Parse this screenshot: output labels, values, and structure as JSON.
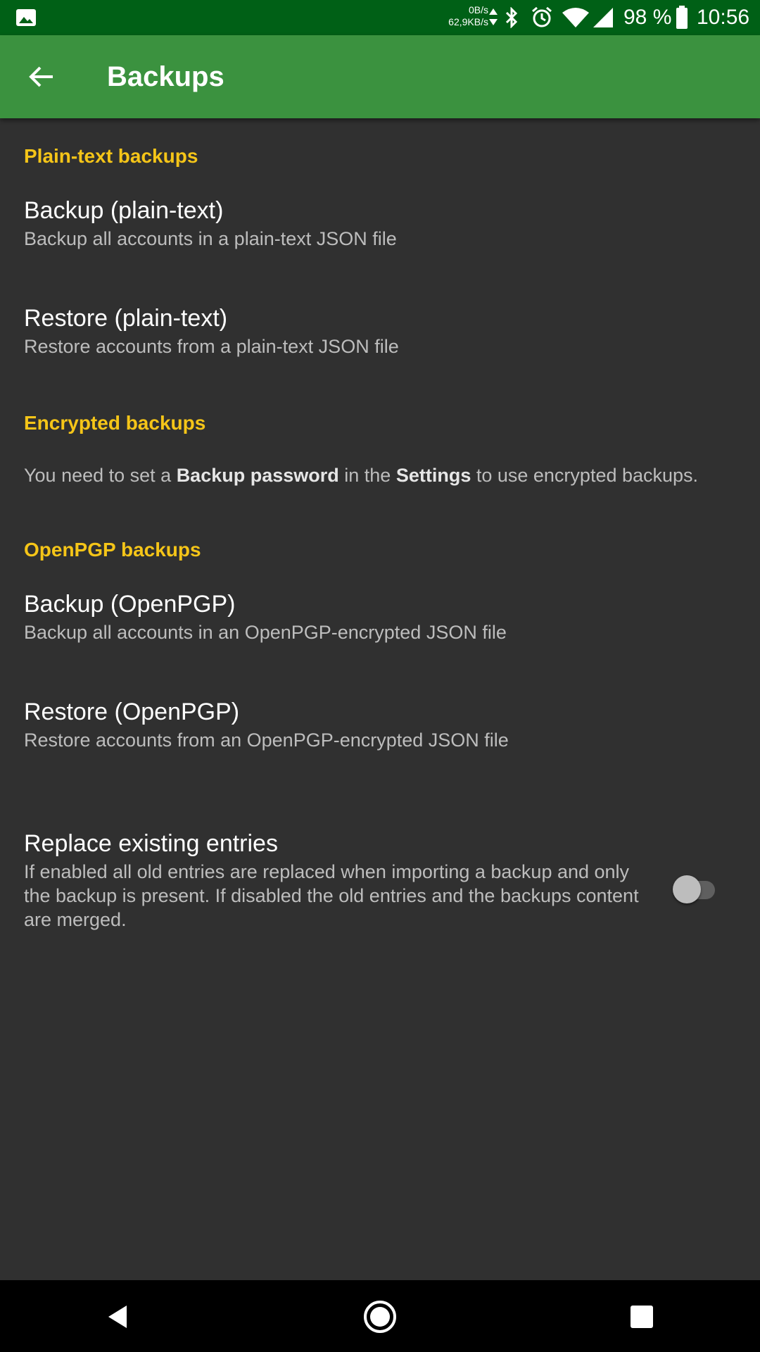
{
  "status_bar": {
    "net_up": "0B/s",
    "net_down": "62,9KB/s",
    "battery_percent": "98 %",
    "time": "10:56",
    "icons": [
      "image-icon",
      "bluetooth-icon",
      "alarm-icon",
      "wifi-icon",
      "cell-signal-icon",
      "battery-icon"
    ]
  },
  "app_bar": {
    "title": "Backups",
    "back_icon": "arrow-back-icon",
    "color": "#3b923f"
  },
  "sections": {
    "plain": {
      "header": "Plain-text backups",
      "backup": {
        "title": "Backup (plain-text)",
        "summary": "Backup all accounts in a plain-text JSON file"
      },
      "restore": {
        "title": "Restore (plain-text)",
        "summary": "Restore accounts from a plain-text JSON file"
      }
    },
    "encrypted": {
      "header": "Encrypted backups",
      "info_pre": "You need to set a ",
      "info_bold1": "Backup password",
      "info_mid": " in the ",
      "info_bold2": "Settings",
      "info_post": " to use encrypted backups."
    },
    "openpgp": {
      "header": "OpenPGP backups",
      "backup": {
        "title": "Backup (OpenPGP)",
        "summary": "Backup all accounts in an OpenPGP-encrypted JSON file"
      },
      "restore": {
        "title": "Restore (OpenPGP)",
        "summary": "Restore accounts from an OpenPGP-encrypted JSON file"
      }
    },
    "replace": {
      "title": "Replace existing entries",
      "summary": "If enabled all old entries are replaced when importing a backup and only the backup is present. If disabled the old entries and the backups content are merged.",
      "enabled": false
    }
  },
  "colors": {
    "status_bar": "#006016",
    "category": "#f5c518",
    "background": "#303030"
  },
  "nav_bar": {
    "icons": [
      "nav-back-icon",
      "nav-home-icon",
      "nav-recents-icon"
    ]
  }
}
